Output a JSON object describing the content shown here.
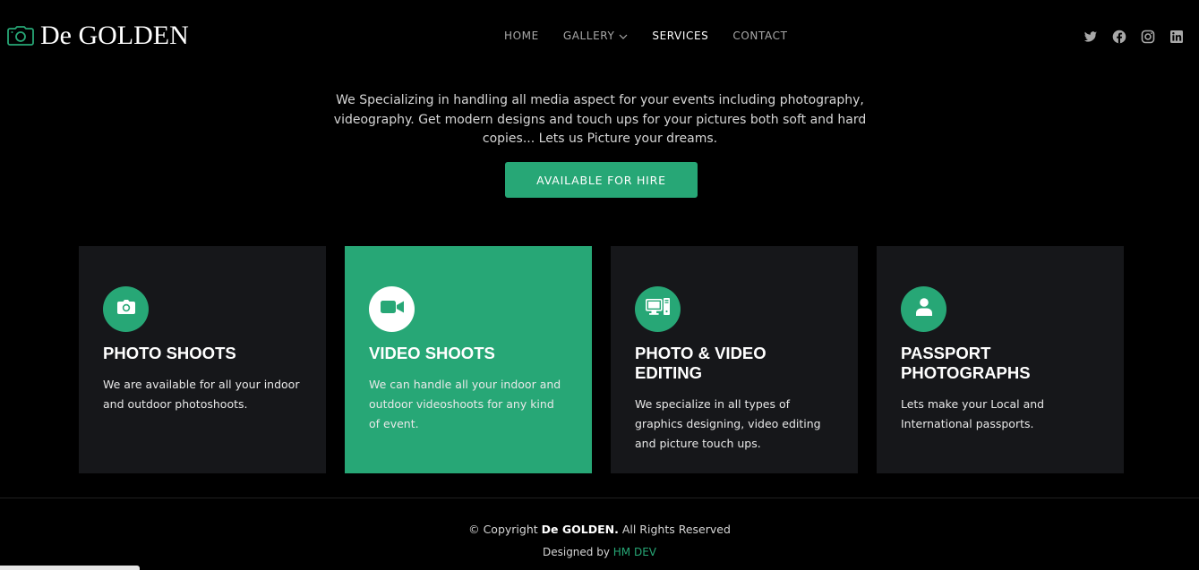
{
  "brand": {
    "name": "De GOLDEN",
    "logo_icon": "camera-icon",
    "accent_color": "#27a776"
  },
  "nav": {
    "items": [
      {
        "label": "HOME"
      },
      {
        "label": "GALLERY"
      },
      {
        "label": "SERVICES"
      },
      {
        "label": "CONTACT"
      }
    ],
    "active": "SERVICES",
    "dropdown_icon": "chevron-down-icon"
  },
  "social": [
    "twitter-icon",
    "facebook-icon",
    "instagram-icon",
    "linkedin-icon"
  ],
  "intro": {
    "text": "We Specializing in handling all media aspect for your events including photography, videography. Get modern designs and touch ups for your pictures both soft and hard copies... Lets us Picture your dreams."
  },
  "cta": {
    "label": "AVAILABLE FOR HIRE"
  },
  "services": [
    {
      "icon": "camera-icon",
      "title": "PHOTO SHOOTS",
      "desc": "We are available for all your indoor and outdoor photoshoots."
    },
    {
      "icon": "video-camera-icon",
      "title": "VIDEO SHOOTS",
      "desc": "We can handle all your indoor and outdoor videoshoots for any kind of event."
    },
    {
      "icon": "pc-display-icon",
      "title": "PHOTO & VIDEO EDITING",
      "desc": "We specialize in all types of graphics designing, video editing and picture touch ups."
    },
    {
      "icon": "person-icon",
      "title": "PASSPORT PHOTOGRAPHS",
      "desc": "Lets make your Local and International passports."
    }
  ],
  "footer": {
    "copyright_prefix": "© Copyright",
    "copyright_brand": "De GOLDEN.",
    "copyright_suffix": "All Rights Reserved",
    "designed_by_prefix": "Designed by",
    "designer": "HM DEV"
  }
}
